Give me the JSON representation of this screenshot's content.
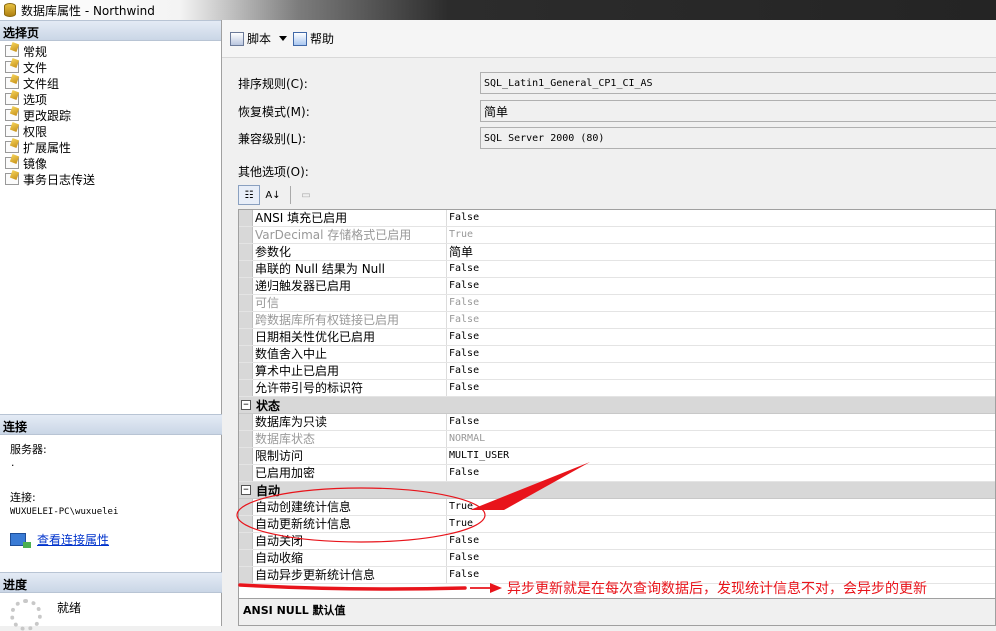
{
  "window": {
    "title": "数据库属性 - Northwind"
  },
  "left_pane": {
    "select_page_header": "选择页",
    "pages": [
      {
        "label": "常规"
      },
      {
        "label": "文件"
      },
      {
        "label": "文件组"
      },
      {
        "label": "选项"
      },
      {
        "label": "更改跟踪"
      },
      {
        "label": "权限"
      },
      {
        "label": "扩展属性"
      },
      {
        "label": "镜像"
      },
      {
        "label": "事务日志传送"
      }
    ],
    "connection_header": "连接",
    "server_label": "服务器:",
    "server_value": ".",
    "connection_label": "连接:",
    "connection_value": "WUXUELEI-PC\\wuxuelei",
    "view_connection_link": "查看连接属性",
    "progress_header": "进度",
    "progress_status": "就绪"
  },
  "toolbar": {
    "script_label": "脚本",
    "help_label": "帮助"
  },
  "form": {
    "collation_label": "排序规则(C):",
    "collation_value": "SQL_Latin1_General_CP1_CI_AS",
    "recovery_label": "恢复模式(M):",
    "recovery_value": "简单",
    "compat_label": "兼容级别(L):",
    "compat_value": "SQL Server 2000 (80)",
    "other_options_label": "其他选项(O):"
  },
  "grid_toolbar": {
    "categorized_icon": "categorized-icon",
    "alpha_label": "A↓",
    "pages_icon": "property-pages-icon"
  },
  "grid": {
    "rows_top": [
      {
        "name": "ANSI 填充已启用",
        "value": "False"
      },
      {
        "name": "VarDecimal 存储格式已启用",
        "value": "True",
        "disabled": true
      },
      {
        "name": "参数化",
        "value": "简单"
      },
      {
        "name": "串联的 Null 结果为 Null",
        "value": "False"
      },
      {
        "name": "递归触发器已启用",
        "value": "False"
      },
      {
        "name": "可信",
        "value": "False",
        "disabled": true
      },
      {
        "name": "跨数据库所有权链接已启用",
        "value": "False",
        "disabled": true
      },
      {
        "name": "日期相关性优化已启用",
        "value": "False"
      },
      {
        "name": "数值舍入中止",
        "value": "False"
      },
      {
        "name": "算术中止已启用",
        "value": "False"
      },
      {
        "name": "允许带引号的标识符",
        "value": "False"
      }
    ],
    "cat_status": "状态",
    "rows_status": [
      {
        "name": "数据库为只读",
        "value": "False"
      },
      {
        "name": "数据库状态",
        "value": "NORMAL",
        "disabled": true
      },
      {
        "name": "限制访问",
        "value": "MULTI_USER"
      },
      {
        "name": "已启用加密",
        "value": "False"
      }
    ],
    "cat_auto": "自动",
    "rows_auto": [
      {
        "name": "自动创建统计信息",
        "value": "True"
      },
      {
        "name": "自动更新统计信息",
        "value": "True"
      },
      {
        "name": "自动关闭",
        "value": "False"
      },
      {
        "name": "自动收缩",
        "value": "False"
      },
      {
        "name": "自动异步更新统计信息",
        "value": "False"
      }
    ],
    "toggle_glyph": "−"
  },
  "description": {
    "title": "ANSI NULL 默认值"
  },
  "annotation": {
    "text": "异步更新就是在每次查询数据后，发现统计信息不对，会异步的更新",
    "color": "#e8141b"
  }
}
